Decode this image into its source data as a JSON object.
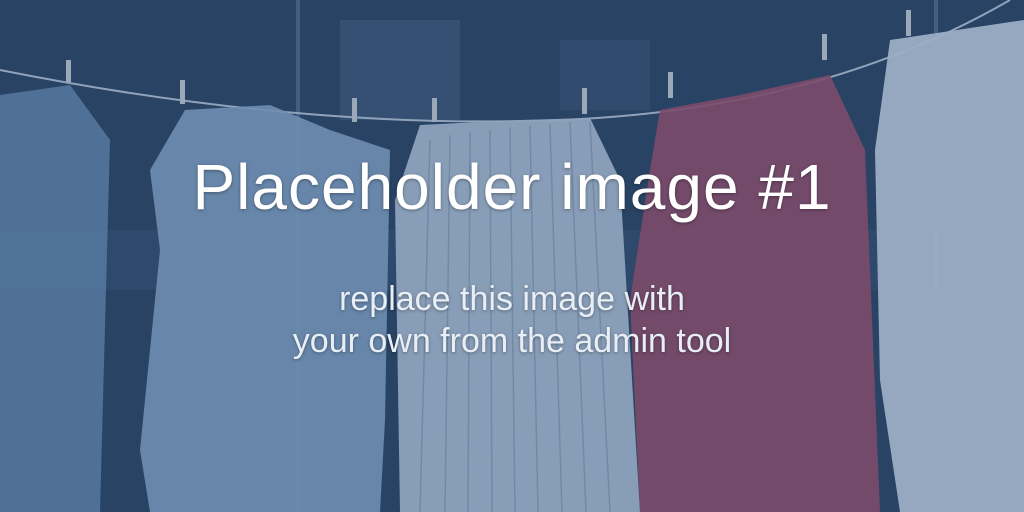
{
  "placeholder": {
    "title": "Placeholder image #1",
    "subtitle_line1": "replace this image with",
    "subtitle_line2": "your own from the admin tool"
  },
  "colors": {
    "overlay": "#2f4a6a",
    "shirt_red": "#b44a63",
    "shirt_white": "#dfe9f3",
    "shirt_blue": "#8fb3d3",
    "text": "#ffffff"
  }
}
